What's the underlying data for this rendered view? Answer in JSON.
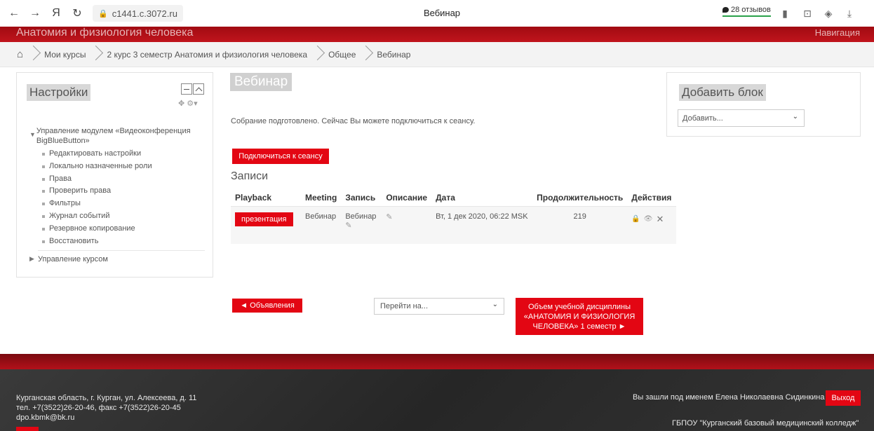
{
  "browser": {
    "url": "c1441.c.3072.ru",
    "tab_title": "Вебинар",
    "reviews": "28 отзывов",
    "brand_glyph": "Я"
  },
  "site": {
    "title": "Анатомия и физиология человека",
    "nav_label": "Навигация"
  },
  "breadcrumb": [
    "Мои курсы",
    "2 курс 3 семестр Анатомия и физиология человека",
    "Общее",
    "Вебинар"
  ],
  "settings": {
    "title": "Настройки",
    "module_label": "Управление модулем «Видеоконференция BigBlueButton»",
    "items": [
      "Редактировать настройки",
      "Локально назначенные роли",
      "Права",
      "Проверить права",
      "Фильтры",
      "Журнал событий",
      "Резервное копирование",
      "Восстановить"
    ],
    "course_label": "Управление курсом"
  },
  "main": {
    "title": "Вебинар",
    "ready_text": "Собрание подготовлено. Сейчас Вы можете подключиться к сеансу.",
    "join_button": "Подключиться к сеансу",
    "records_title": "Записи",
    "table": {
      "headers": [
        "Playback",
        "Meeting",
        "Запись",
        "Описание",
        "Дата",
        "Продолжительность",
        "Действия"
      ],
      "row": {
        "playback": "презентация",
        "meeting": "Вебинар",
        "recording": "Вебинар",
        "description": "",
        "date": "Вт, 1 дек 2020, 06:22 MSK",
        "duration": "219"
      }
    }
  },
  "navigation": {
    "prev": "◄ Объявления",
    "jump_placeholder": "Перейти на...",
    "next": "Объем учебной дисциплины «АНАТОМИЯ И ФИЗИОЛОГИЯ ЧЕЛОВЕКА» 1 семестр ►"
  },
  "add_block": {
    "title": "Добавить блок",
    "select": "Добавить..."
  },
  "footer": {
    "address": "Курганская область, г. Курган, ул. Алексеева, д. 11",
    "phone": "тел. +7(3522)26-20-46, факс +7(3522)26-20-45",
    "email": "dpo.kbmk@bk.ru",
    "logged_in": "Вы зашли под именем Елена Николаевна Сидинкина",
    "logout": "Выход",
    "org": "ГБПОУ \"Курганский базовый медицинский колледж\""
  },
  "colors": {
    "accent_red": "#e30613",
    "header_red": "#b40c14"
  }
}
